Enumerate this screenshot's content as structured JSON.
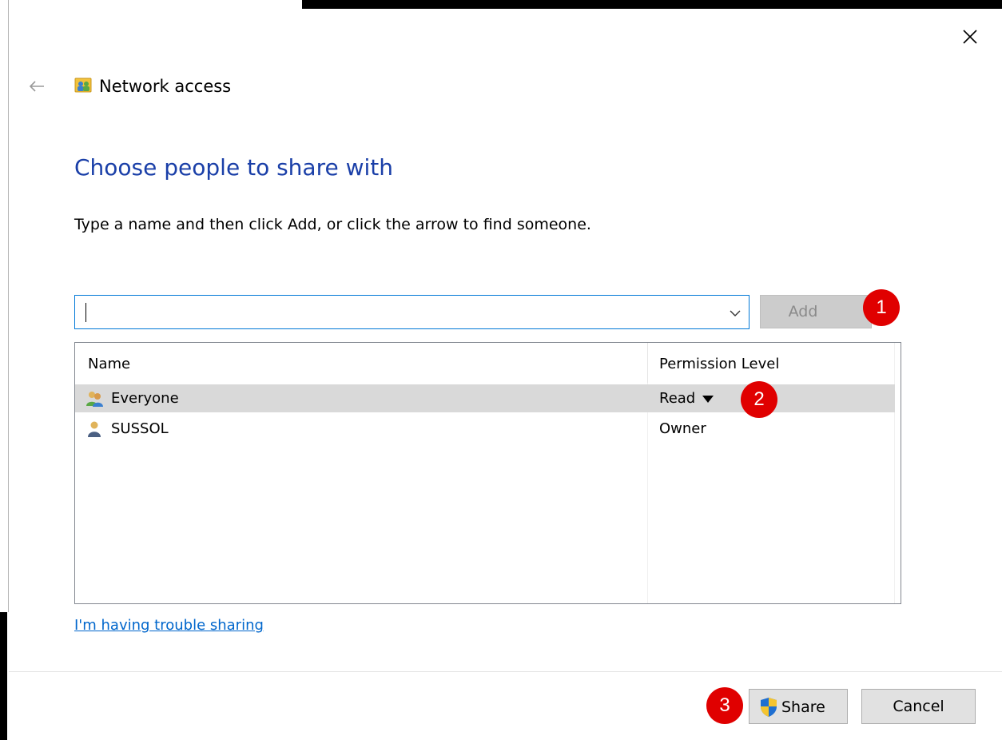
{
  "window": {
    "title": "Network access",
    "close_icon": "close-icon",
    "back_icon": "back-arrow-icon"
  },
  "main": {
    "heading": "Choose people to share with",
    "instruction": "Type a name and then click Add, or click the arrow to find someone.",
    "name_input": {
      "value": "",
      "placeholder": ""
    },
    "add_label": "Add",
    "badges": [
      "1",
      "2",
      "3"
    ]
  },
  "list": {
    "columns": [
      "Name",
      "Permission Level"
    ],
    "rows": [
      {
        "name": "Everyone",
        "permission": "Read",
        "icon": "user-group-icon",
        "selected": true
      },
      {
        "name": "SUSSOL",
        "permission": "Owner",
        "icon": "user-icon",
        "selected": false
      }
    ]
  },
  "links": {
    "trouble": "I'm having trouble sharing"
  },
  "footer": {
    "share_label": "Share",
    "cancel_label": "Cancel"
  },
  "colors": {
    "heading": "#1a3fa8",
    "link": "#0066cc",
    "badge": "#e00000",
    "selection": "#d9d9d9",
    "focus_border": "#0078d7"
  }
}
